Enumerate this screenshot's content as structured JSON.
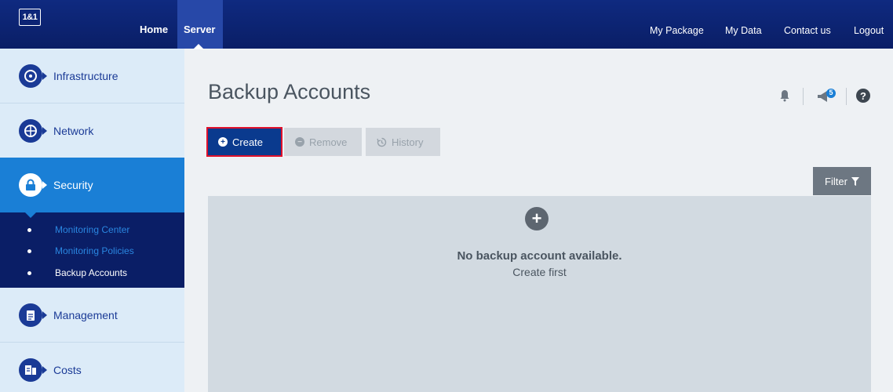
{
  "topbar": {
    "logo": "1&1",
    "nav_left": [
      "Home",
      "Server"
    ],
    "nav_right": [
      "My Package",
      "My Data",
      "Contact us",
      "Logout"
    ]
  },
  "sidebar": {
    "items": [
      {
        "label": "Infrastructure",
        "icon": "globe-icon"
      },
      {
        "label": "Network",
        "icon": "network-icon"
      },
      {
        "label": "Security",
        "icon": "lock-icon"
      },
      {
        "label": "Management",
        "icon": "clipboard-icon"
      },
      {
        "label": "Costs",
        "icon": "costs-icon"
      }
    ],
    "security_sub": [
      "Monitoring Center",
      "Monitoring Policies",
      "Backup Accounts"
    ]
  },
  "main": {
    "title": "Backup Accounts",
    "notification_count": "5",
    "toolbar": {
      "create": "Create",
      "remove": "Remove",
      "history": "History"
    },
    "filter": "Filter",
    "empty_title": "No backup account available.",
    "empty_sub": "Create first"
  },
  "colors": {
    "brand": "#0a1e66",
    "active": "#1a7fd6",
    "highlight": "#e0112b"
  }
}
